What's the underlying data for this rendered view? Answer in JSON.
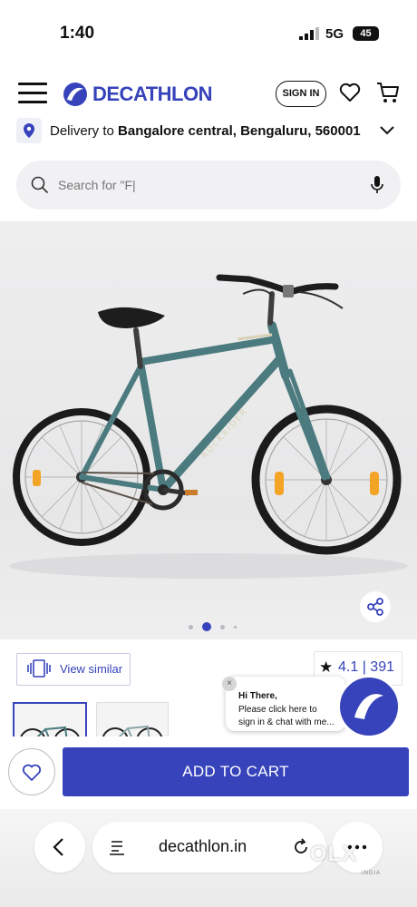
{
  "status_bar": {
    "time": "1:40",
    "network": "5G",
    "battery": "45"
  },
  "header": {
    "brand": "DECATHLON",
    "signin_label": "SIGN IN"
  },
  "delivery": {
    "prefix": "Delivery to ",
    "location": "Bangalore central, Bengaluru, 560001"
  },
  "search": {
    "placeholder": "Search for \"F|"
  },
  "product": {
    "carousel_active_index": 1,
    "carousel_count": 4,
    "frame_text": "ROCKRIDER"
  },
  "actions": {
    "view_similar_label": "View similar"
  },
  "rating": {
    "star": "★",
    "value": "4.1 | 391"
  },
  "chat": {
    "close": "×",
    "greeting": "Hi There,",
    "line2": "Please click here to",
    "line3": "sign in & chat with me..."
  },
  "cta": {
    "add_to_cart_label": "ADD TO CART"
  },
  "browser": {
    "url": "decathlon.in"
  },
  "watermark": {
    "brand": "OLX",
    "sub": "INDIA"
  },
  "colors": {
    "brand_blue": "#3643ba",
    "frame_green": "#4c7b7f",
    "reflector": "#f4a425"
  }
}
